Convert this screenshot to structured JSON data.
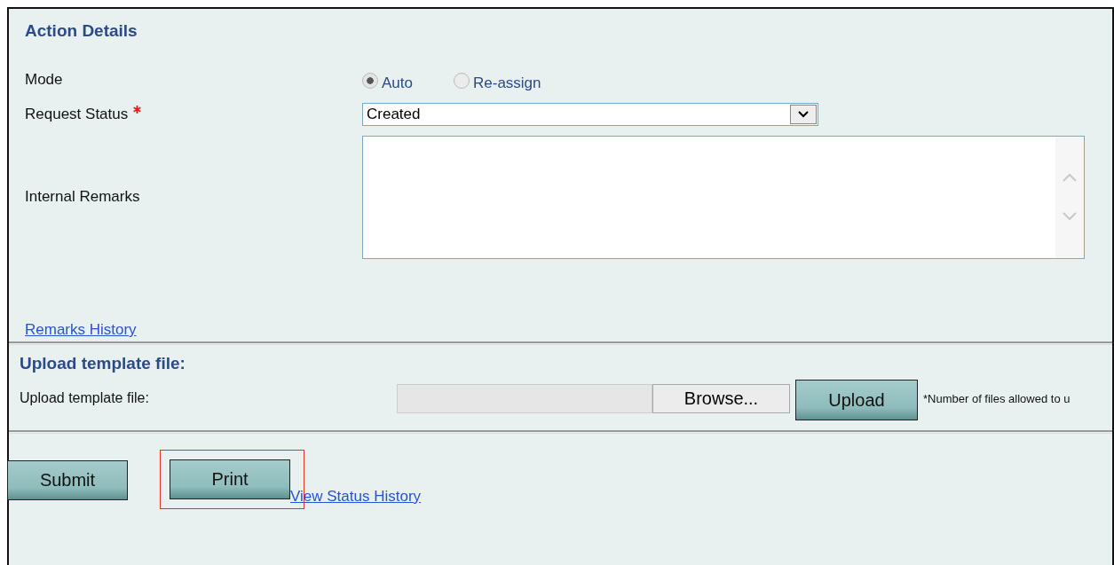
{
  "section_title": "Action Details",
  "mode": {
    "label": "Mode",
    "options": [
      {
        "label": "Auto",
        "selected": true
      },
      {
        "label": "Re-assign",
        "selected": false
      }
    ]
  },
  "request_status": {
    "label": "Request Status",
    "required": true,
    "value": "Created"
  },
  "internal_remarks": {
    "label": "Internal Remarks"
  },
  "remarks_history_link": "Remarks History",
  "upload": {
    "title": "Upload template file:",
    "label": "Upload template file:",
    "browse_button": "Browse...",
    "upload_button": "Upload",
    "note": "*Number of files allowed to u"
  },
  "buttons": [
    {
      "label": "Submit",
      "highlighted": false
    },
    {
      "label": "Print",
      "highlighted": true
    }
  ],
  "status_history_link": "View Status History"
}
